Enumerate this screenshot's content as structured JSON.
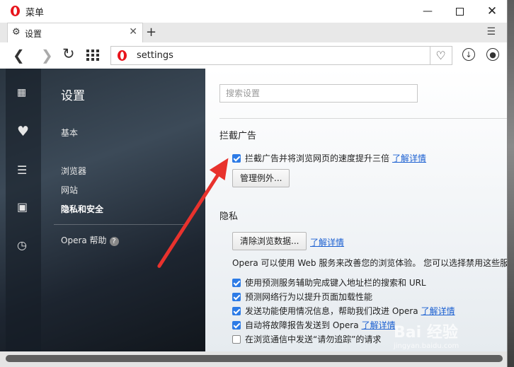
{
  "window": {
    "title": "菜单",
    "controls": [
      "minimize",
      "maximize",
      "close"
    ]
  },
  "tabs": [
    {
      "label": "设置",
      "icon": "gear-icon"
    }
  ],
  "toolbar": {
    "url": "settings"
  },
  "sidebar": {
    "title": "设置",
    "rail_icons": [
      "speed-dial-icon",
      "heart-icon",
      "news-icon",
      "desktop-icon",
      "history-icon"
    ],
    "items": [
      {
        "label": "基本",
        "active": false
      },
      {
        "label": "浏览器",
        "active": false
      },
      {
        "label": "网站",
        "active": false
      },
      {
        "label": "隐私和安全",
        "active": true
      }
    ],
    "help": "Opera 帮助"
  },
  "main": {
    "search_placeholder": "搜索设置",
    "adblock": {
      "heading": "拦截广告",
      "checkbox_label": "拦截广告并将浏览网页的速度提升三倍",
      "checked": true,
      "link": "了解详情",
      "exceptions_button": "管理例外..."
    },
    "privacy": {
      "heading": "隐私",
      "clear_button": "清除浏览数据...",
      "clear_link": "了解详情",
      "info": "Opera 可以使用 Web 服务来改善您的浏览体验。 您可以选择禁用这些服",
      "options": [
        {
          "label": "使用预测服务辅助完成键入地址栏的搜索和 URL",
          "checked": true,
          "link": ""
        },
        {
          "label": "预测网络行为以提升页面加载性能",
          "checked": true,
          "link": ""
        },
        {
          "label": "发送功能使用情况信息，帮助我们改进 Opera",
          "checked": true,
          "link": "了解详情"
        },
        {
          "label": "自动将故障报告发送到 Opera",
          "checked": true,
          "link": "了解详情"
        },
        {
          "label": "在浏览通信中发送“请勿追踪”的请求",
          "checked": false,
          "link": ""
        }
      ]
    }
  },
  "watermark": {
    "text": "Bai 经验",
    "url": "jingyan.baidu.com"
  },
  "colors": {
    "accent": "#2d7be6",
    "link": "#1a5fd1",
    "annotation": "#e8322d"
  }
}
